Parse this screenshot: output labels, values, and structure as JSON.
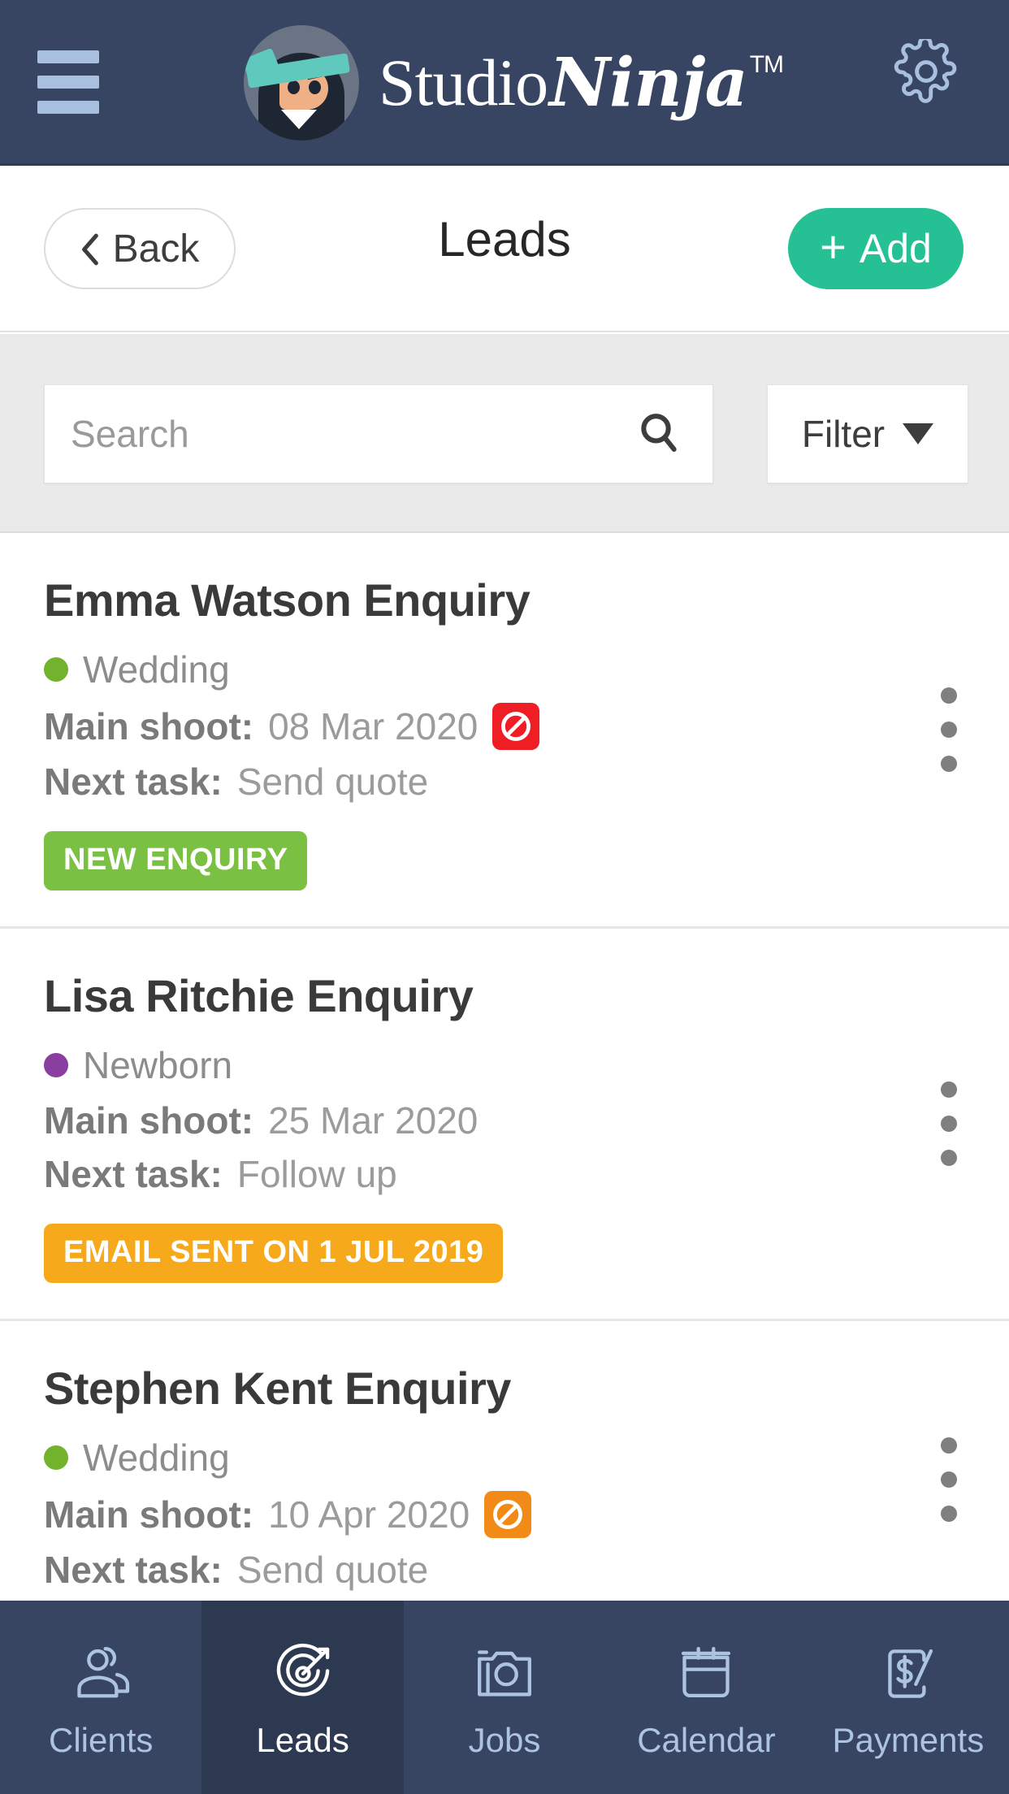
{
  "header": {
    "menu_icon": "hamburger-menu-icon",
    "brand_studio": "Studio",
    "brand_ninja": "Ninja",
    "brand_tm": "TM",
    "settings_icon": "gear-icon",
    "bg_color": "#374563"
  },
  "subnav": {
    "back_label": "Back",
    "back_icon": "chevron-left-icon",
    "title": "Leads",
    "add_label": "Add",
    "add_icon": "plus-icon",
    "add_color": "#25c194"
  },
  "search": {
    "placeholder": "Search",
    "value": "",
    "search_icon": "search-icon",
    "filter_label": "Filter",
    "filter_caret_icon": "chevron-down-icon"
  },
  "labels": {
    "main_shoot": "Main shoot:",
    "next_task": "Next task:"
  },
  "leads": [
    {
      "title": "Emma Watson Enquiry",
      "category": "Wedding",
      "category_color": "#72b22c",
      "main_shoot": "08 Mar 2020",
      "next_task": "Send quote",
      "block_icon": "no-entry-icon",
      "block_color": "#ef1d24",
      "badge": "NEW ENQUIRY",
      "badge_color": "#7ac143"
    },
    {
      "title": "Lisa Ritchie Enquiry",
      "category": "Newborn",
      "category_color": "#8a3fa0",
      "main_shoot": "25 Mar 2020",
      "next_task": "Follow up",
      "block_icon": "",
      "block_color": "",
      "badge": "EMAIL SENT ON 1 JUL 2019",
      "badge_color": "#f5a91b"
    },
    {
      "title": "Stephen Kent Enquiry",
      "category": "Wedding",
      "category_color": "#72b22c",
      "main_shoot": "10 Apr 2020",
      "next_task": "Send quote",
      "block_icon": "no-entry-icon",
      "block_color": "#f18a16",
      "badge": "",
      "badge_color": ""
    }
  ],
  "tabs": [
    {
      "label": "Clients",
      "icon": "users-icon",
      "active": false
    },
    {
      "label": "Leads",
      "icon": "target-icon",
      "active": true
    },
    {
      "label": "Jobs",
      "icon": "camera-icon",
      "active": false
    },
    {
      "label": "Calendar",
      "icon": "calendar-icon",
      "active": false
    },
    {
      "label": "Payments",
      "icon": "dollar-receipt-icon",
      "active": false
    }
  ]
}
